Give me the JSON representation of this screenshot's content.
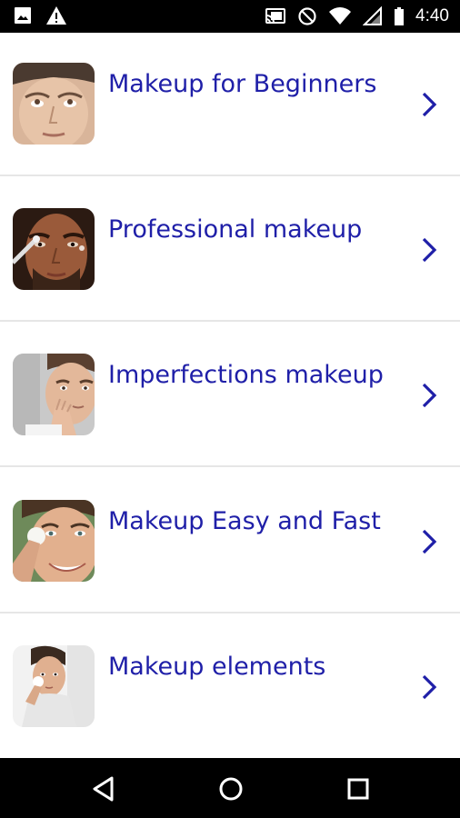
{
  "status_bar": {
    "time": "4:40",
    "left_icons": [
      "image-icon",
      "warning-icon"
    ],
    "right_icons": [
      "cast-icon",
      "do-not-disturb-icon",
      "wifi-icon",
      "signal-icon",
      "battery-icon"
    ]
  },
  "list": {
    "items": [
      {
        "label": "Makeup for Beginners",
        "thumb": "man-face-looking-up"
      },
      {
        "label": "Professional makeup",
        "thumb": "man-face-with-brush"
      },
      {
        "label": "Imperfections makeup",
        "thumb": "man-touching-face"
      },
      {
        "label": "Makeup Easy and Fast",
        "thumb": "man-smiling-cotton-pad"
      },
      {
        "label": "Makeup elements",
        "thumb": "man-with-cotton-pad"
      }
    ]
  },
  "nav_bar": {
    "buttons": [
      "back-icon",
      "home-icon",
      "recents-icon"
    ]
  },
  "colors": {
    "title": "#1f1fa8",
    "chevron": "#1f1fa8",
    "divider": "#e6e6e6",
    "bars": "#000000"
  }
}
